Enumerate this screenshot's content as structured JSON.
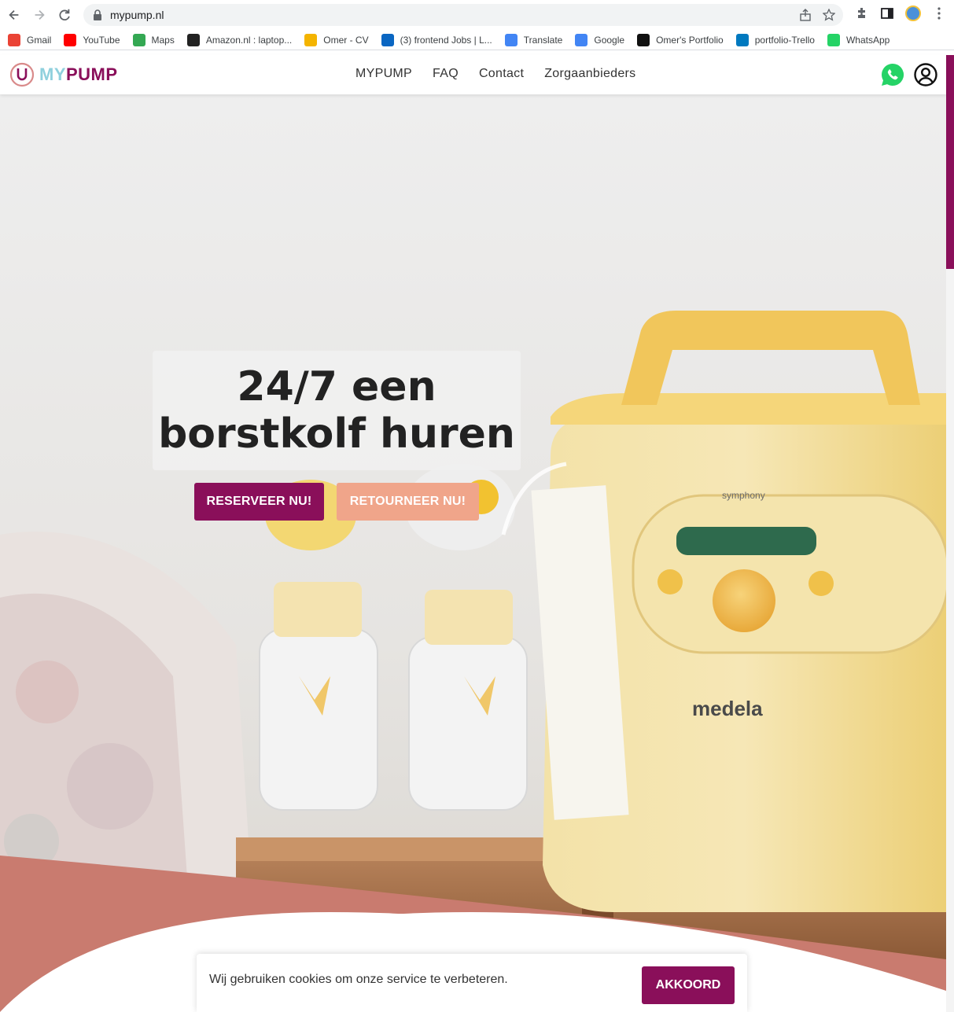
{
  "browser": {
    "url": "mypump.nl",
    "bookmarks": [
      {
        "label": "Gmail",
        "icon": "gmail-icon",
        "color": "#ea4335"
      },
      {
        "label": "YouTube",
        "icon": "youtube-icon",
        "color": "#ff0000"
      },
      {
        "label": "Maps",
        "icon": "maps-icon",
        "color": "#34a853"
      },
      {
        "label": "Amazon.nl : laptop...",
        "icon": "amazon-icon",
        "color": "#222222"
      },
      {
        "label": "Omer - CV",
        "icon": "slides-icon",
        "color": "#f4b400"
      },
      {
        "label": "(3) frontend Jobs | L...",
        "icon": "linkedin-icon",
        "color": "#0a66c2"
      },
      {
        "label": "Translate",
        "icon": "translate-icon",
        "color": "#4285f4"
      },
      {
        "label": "Google",
        "icon": "google-icon",
        "color": "#4285f4"
      },
      {
        "label": "Omer's Portfolio",
        "icon": "portfolio-icon",
        "color": "#111111"
      },
      {
        "label": "portfolio-Trello",
        "icon": "trello-icon",
        "color": "#0079bf"
      },
      {
        "label": "WhatsApp",
        "icon": "whatsapp-icon",
        "color": "#25d366"
      }
    ]
  },
  "header": {
    "logo_my": "MY",
    "logo_pump": "PUMP",
    "nav": [
      "MYPUMP",
      "FAQ",
      "Contact",
      "Zorgaanbieders"
    ]
  },
  "hero": {
    "title_line1": "24/7 een",
    "title_line2": "borstkolf huren",
    "reserve_label": "RESERVEER NU!",
    "return_label": "RETOURNEER NU!",
    "product_brand": "medela",
    "product_model": "symphony"
  },
  "cookie": {
    "text": "Wij gebruiken cookies om onze service te verbeteren.",
    "accept_label": "AKKOORD"
  },
  "colors": {
    "brand": "#8a0f5a",
    "accent": "#f0a58a",
    "arc": "#c97b6f"
  }
}
